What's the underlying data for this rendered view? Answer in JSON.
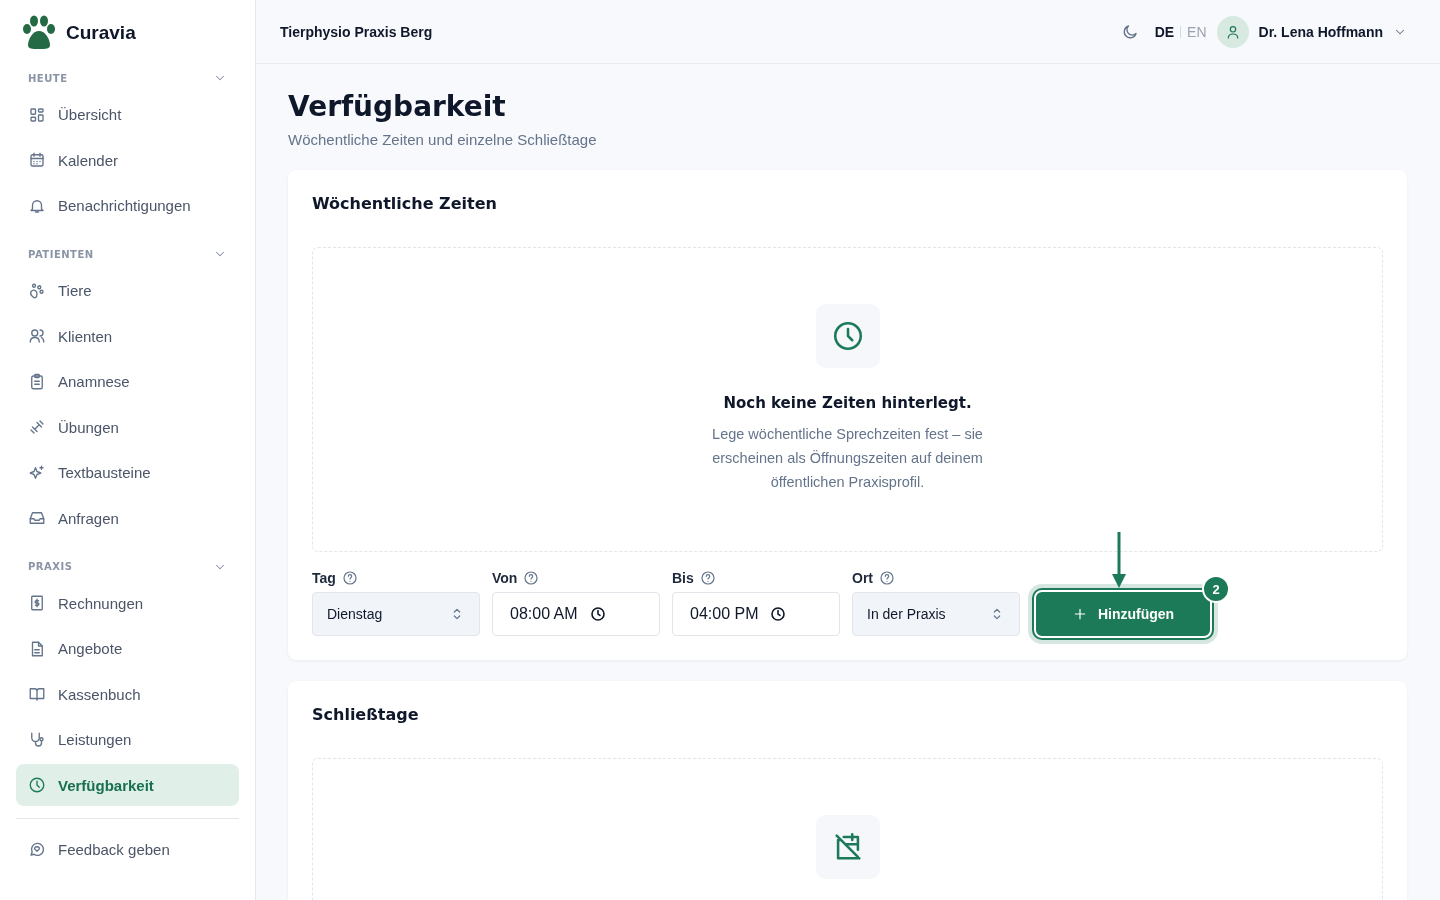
{
  "sidebar": {
    "brand": "Curavia",
    "sections": [
      {
        "title": "HEUTE",
        "expanded": true,
        "items": [
          {
            "label": "Übersicht",
            "selected": false
          },
          {
            "label": "Kalender",
            "selected": false
          },
          {
            "label": "Benachrichtigungen",
            "selected": false
          }
        ]
      },
      {
        "title": "PATIENTEN",
        "expanded": true,
        "items": [
          {
            "label": "Tiere",
            "selected": false
          },
          {
            "label": "Klienten",
            "selected": false
          },
          {
            "label": "Anamnese",
            "selected": false
          },
          {
            "label": "Übungen",
            "selected": false
          },
          {
            "label": "Textbausteine",
            "selected": false
          },
          {
            "label": "Anfragen",
            "selected": false
          }
        ]
      },
      {
        "title": "PRAXIS",
        "expanded": true,
        "items": [
          {
            "label": "Rechnungen",
            "selected": false
          },
          {
            "label": "Angebote",
            "selected": false
          },
          {
            "label": "Kassenbuch",
            "selected": false
          },
          {
            "label": "Leistungen",
            "selected": false
          },
          {
            "label": "Verfügbarkeit",
            "selected": true
          }
        ]
      }
    ],
    "footer_items": [
      {
        "label": "Feedback geben",
        "selected": false
      }
    ]
  },
  "header": {
    "practice": "Tierphysio Praxis Berg",
    "languages": [
      {
        "label": "DE",
        "selected": true
      },
      {
        "label": "EN",
        "selected": false
      }
    ],
    "user": "Dr. Lena Hoffmann"
  },
  "page": {
    "title": "Verfügbarkeit",
    "subtitle": "Wöchentliche Zeiten und einzelne Schließtage"
  },
  "weekly": {
    "title": "Wöchentliche Zeiten",
    "empty": {
      "title": "Noch keine Zeiten hinterlegt.",
      "text": "Lege wöchentliche Sprechzeiten fest – sie erscheinen als Öffnungszeiten auf deinem öffentlichen Praxisprofil."
    },
    "fields": [
      {
        "label": "Tag",
        "kind": "select",
        "value": "Dienstag"
      },
      {
        "label": "Von",
        "kind": "time",
        "value": "08:00 AM"
      },
      {
        "label": "Bis",
        "kind": "time",
        "value": "04:00 PM"
      },
      {
        "label": "Ort",
        "kind": "select",
        "value": "In der Praxis"
      }
    ],
    "add_button": {
      "label": "Hinzufügen",
      "highlighted": true,
      "badge": "2"
    }
  },
  "closures": {
    "title": "Schließtage"
  }
}
